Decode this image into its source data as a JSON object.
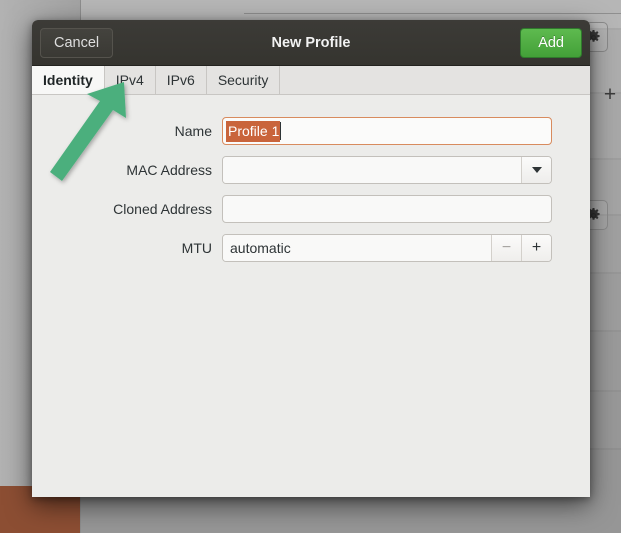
{
  "dialog": {
    "title": "New Profile",
    "cancel_label": "Cancel",
    "add_label": "Add",
    "tabs": [
      {
        "label": "Identity",
        "active": true
      },
      {
        "label": "IPv4",
        "active": false
      },
      {
        "label": "IPv6",
        "active": false
      },
      {
        "label": "Security",
        "active": false
      }
    ],
    "fields": {
      "name": {
        "label": "Name",
        "value": "Profile 1",
        "selected": true
      },
      "mac_address": {
        "label": "MAC Address",
        "value": "",
        "placeholder": ""
      },
      "cloned_address": {
        "label": "Cloned Address",
        "value": "",
        "placeholder": ""
      },
      "mtu": {
        "label": "MTU",
        "value": "automatic",
        "decrement_label": "−",
        "increment_label": "+"
      }
    }
  },
  "background": {
    "gear_icon_name": "gear-icon",
    "plus_label": "+"
  },
  "annotation": {
    "type": "arrow",
    "points_to": "IPv4",
    "color": "#4caf7d"
  },
  "colors": {
    "accent_green": "#4ea844",
    "selection_orange": "#c9643b",
    "focus_border": "#d88b5e",
    "titlebar_dark": "#3a3934",
    "dialog_bg": "#ececea",
    "annotation_green": "#4caf7d"
  }
}
